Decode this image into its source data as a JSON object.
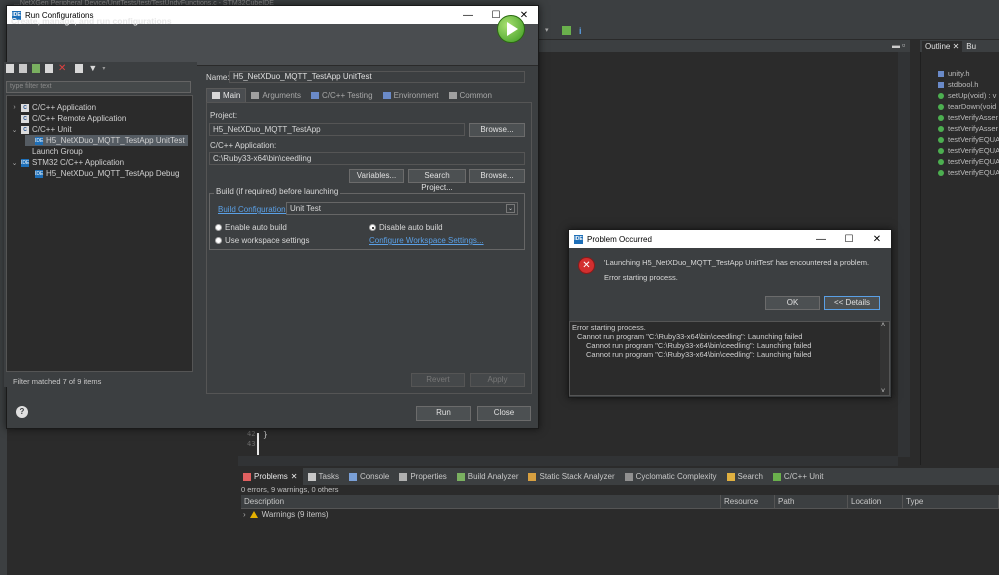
{
  "ide": {
    "path_text": "...NetXGen Peripheral Device/UnitTests/test/TestUndvFunctions.c - STM32CubeIDE",
    "line_numbers": [
      "42",
      "43"
    ],
    "code_brace": "}",
    "outline": {
      "tab_outline": "Outline",
      "tab_build": "Bu",
      "items": [
        {
          "label": "unity.h",
          "kind": "include"
        },
        {
          "label": "stdbool.h",
          "kind": "include"
        },
        {
          "label": "setUp(void) : v",
          "kind": "fn"
        },
        {
          "label": "tearDown(void",
          "kind": "fn"
        },
        {
          "label": "testVerifyAsser",
          "kind": "fn"
        },
        {
          "label": "testVerifyAsser",
          "kind": "fn"
        },
        {
          "label": "testVerifyEQUA",
          "kind": "fn"
        },
        {
          "label": "testVerifyEQUA",
          "kind": "fn"
        },
        {
          "label": "testVerifyEQUA",
          "kind": "fn"
        },
        {
          "label": "testVerifyEQUA",
          "kind": "fn"
        }
      ]
    },
    "bottom_tabs": [
      {
        "label": "Problems",
        "active": true,
        "closable": true
      },
      {
        "label": "Tasks"
      },
      {
        "label": "Console"
      },
      {
        "label": "Properties"
      },
      {
        "label": "Build Analyzer"
      },
      {
        "label": "Static Stack Analyzer"
      },
      {
        "label": "Cyclomatic Complexity"
      },
      {
        "label": "Search"
      },
      {
        "label": "C/C++ Unit"
      }
    ],
    "problems_summary": "0 errors, 9 warnings, 0 others",
    "problems_columns": [
      "Description",
      "Resource",
      "Path",
      "Location",
      "Type"
    ],
    "problems_row": "Warnings (9 items)"
  },
  "run_config": {
    "title": "Run Configurations",
    "header_title": "Create, manage, and run configurations",
    "filter_placeholder": "type filter text",
    "tree": [
      {
        "label": "C/C++ Application",
        "level": 0,
        "arrow": ">",
        "icon": "C"
      },
      {
        "label": "C/C++ Remote Application",
        "level": 0,
        "arrow": "",
        "icon": "C"
      },
      {
        "label": "C/C++ Unit",
        "level": 0,
        "arrow": "v",
        "icon": "C"
      },
      {
        "label": "H5_NetXDuo_MQTT_TestApp UnitTest",
        "level": 1,
        "arrow": "",
        "icon": "IDE",
        "selected": true
      },
      {
        "label": "Launch Group",
        "level": 0,
        "arrow": "",
        "icon": ""
      },
      {
        "label": "STM32 C/C++ Application",
        "level": 0,
        "arrow": "v",
        "icon": "IDE"
      },
      {
        "label": "H5_NetXDuo_MQTT_TestApp Debug",
        "level": 1,
        "arrow": "",
        "icon": "IDE"
      }
    ],
    "filter_status": "Filter matched 7 of 9 items",
    "name_label": "Name:",
    "name_value": "H5_NetXDuo_MQTT_TestApp UnitTest",
    "tabs": [
      {
        "label": "Main",
        "active": true
      },
      {
        "label": "Arguments"
      },
      {
        "label": "C/C++ Testing"
      },
      {
        "label": "Environment"
      },
      {
        "label": "Common"
      }
    ],
    "project_label": "Project:",
    "project_value": "H5_NetXDuo_MQTT_TestApp",
    "browse_label": "Browse...",
    "app_label": "C/C++ Application:",
    "app_value": "C:\\Ruby33-x64\\bin\\ceedling",
    "variables_label": "Variables...",
    "search_project_label": "Search Project...",
    "build_group_label": "Build (if required) before launching",
    "build_config_link": "Build Configuration:",
    "build_config_value": "Unit Test",
    "enable_auto_build": "Enable auto build",
    "disable_auto_build": "Disable auto build",
    "use_workspace": "Use workspace settings",
    "configure_workspace_link": "Configure Workspace Settings...",
    "revert_label": "Revert",
    "apply_label": "Apply",
    "run_label": "Run",
    "close_label": "Close",
    "help_label": "?"
  },
  "problem_dialog": {
    "title": "Problem Occurred",
    "message": "'Launching H5_NetXDuo_MQTT_TestApp UnitTest' has encountered a problem.",
    "sub_message": "Error starting process.",
    "ok_label": "OK",
    "details_label": "<< Details",
    "details_lines": [
      "Error starting process.",
      "Cannot run program \"C:\\Ruby33-x64\\bin\\ceedling\": Launching failed",
      "Cannot run program \"C:\\Ruby33-x64\\bin\\ceedling\": Launching failed",
      "Cannot run program \"C:\\Ruby33-x64\\bin\\ceedling\": Launching failed"
    ]
  },
  "colors": {
    "error_red": "#d32f2f",
    "run_green": "#3a9a20",
    "link_blue": "#5aa0e6",
    "warning_yellow": "#e5b000"
  }
}
